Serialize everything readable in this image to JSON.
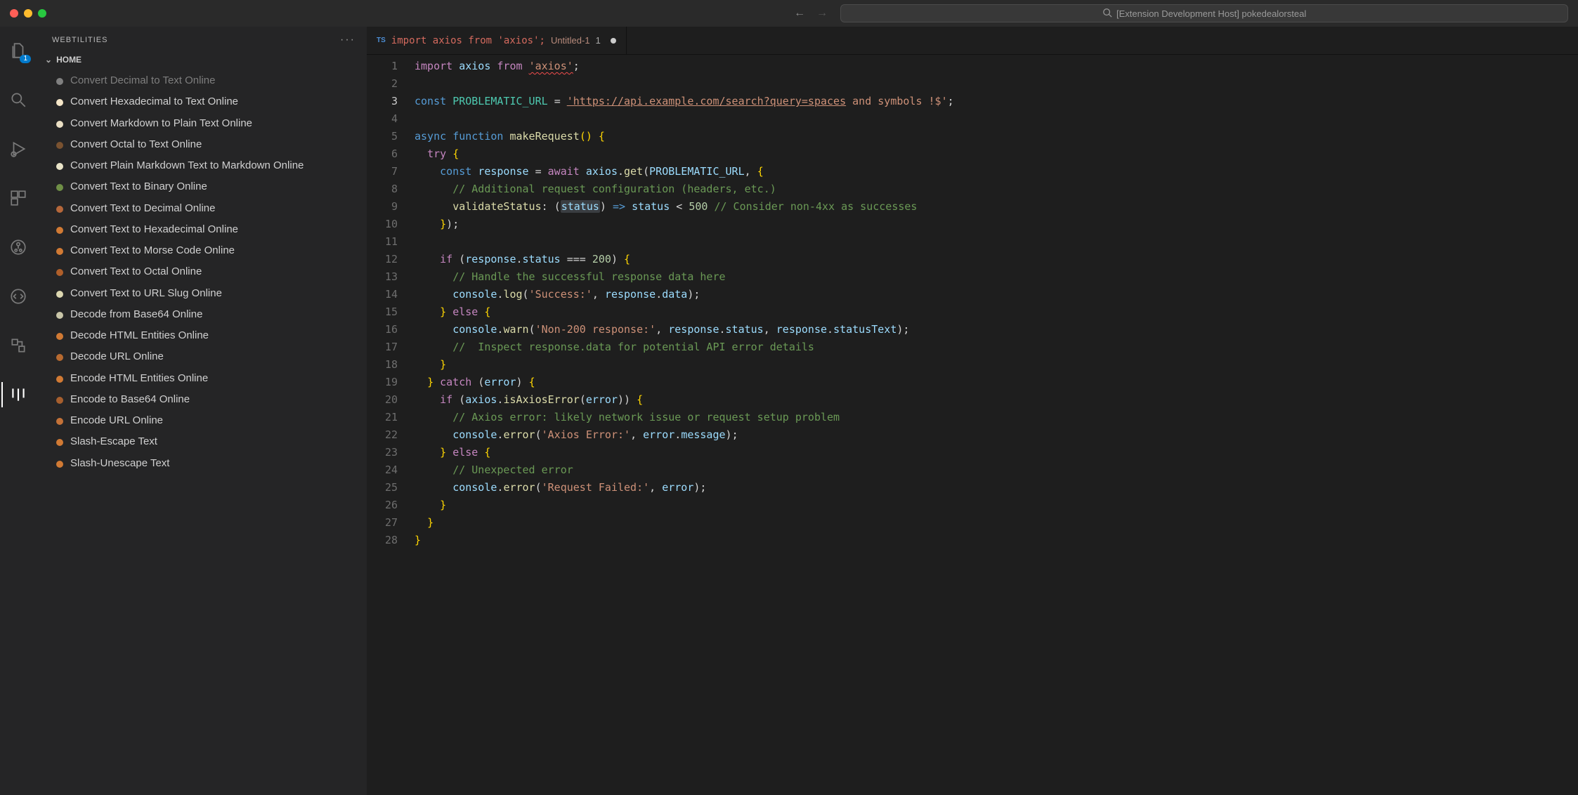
{
  "titlebar": {
    "search_placeholder": "[Extension Development Host] pokedealorsteal"
  },
  "activity": {
    "explorer_badge": "1"
  },
  "sidebar": {
    "title": "WEBTILITIES",
    "section": "HOME",
    "items": [
      {
        "label": "Convert Decimal to Text Online",
        "color": "#808080",
        "cut": true
      },
      {
        "label": "Convert Hexadecimal to Text Online",
        "color": "#f5e6c8"
      },
      {
        "label": "Convert Markdown to Plain Text Online",
        "color": "#eadfc4"
      },
      {
        "label": "Convert Octal to Text Online",
        "color": "#7a5230"
      },
      {
        "label": "Convert Plain Markdown Text to Markdown Online",
        "color": "#e9e4c8"
      },
      {
        "label": "Convert Text to Binary Online",
        "color": "#6f8f46"
      },
      {
        "label": "Convert Text to Decimal Online",
        "color": "#b5673a"
      },
      {
        "label": "Convert Text to Hexadecimal Online",
        "color": "#d17a34"
      },
      {
        "label": "Convert Text to Morse Code Online",
        "color": "#d17a34"
      },
      {
        "label": "Convert Text to Octal Online",
        "color": "#b05f2a"
      },
      {
        "label": "Convert Text to URL Slug Online",
        "color": "#dcd7b0"
      },
      {
        "label": "Decode from Base64 Online",
        "color": "#c9c6a8"
      },
      {
        "label": "Decode HTML Entities Online",
        "color": "#d17a34"
      },
      {
        "label": "Decode URL Online",
        "color": "#b86a30"
      },
      {
        "label": "Encode HTML Entities Online",
        "color": "#d17a34"
      },
      {
        "label": "Encode to Base64 Online",
        "color": "#a75f2e"
      },
      {
        "label": "Encode URL Online",
        "color": "#c47238"
      },
      {
        "label": "Slash-Escape Text",
        "color": "#d17a34"
      },
      {
        "label": "Slash-Unescape Text",
        "color": "#d17a34"
      }
    ]
  },
  "editor": {
    "tab": {
      "lang_badge": "TS",
      "title": "import axios from 'axios';",
      "sub": "Untitled-1",
      "num": "1"
    },
    "line_count": 28,
    "highlighted_line": 3,
    "strings": {
      "axios_module": "'axios'",
      "url_part1": "'https://api.example.com/search?query=spaces",
      "url_part2": " and symbols !$'",
      "success_label": "'Success:'",
      "non200_label": "'Non-200 response:'",
      "axios_err_label": "'Axios Error:'",
      "req_failed_label": "'Request Failed:'"
    },
    "identifiers": {
      "const_url": "PROBLEMATIC_URL",
      "fn_name": "makeRequest",
      "response": "response",
      "axios": "axios",
      "validateStatus": "validateStatus",
      "status_param": "status",
      "error": "error",
      "console": "console",
      "data_prop": "data",
      "status_prop": "status",
      "statusText_prop": "statusText",
      "message_prop": "message",
      "isAxiosError": "isAxiosError",
      "get": "get",
      "log": "log",
      "warn": "warn",
      "errorfn": "error"
    },
    "numbers": {
      "n500": "500",
      "n200": "200"
    },
    "comments": {
      "c1": "// Additional request configuration (headers, etc.)",
      "c2": "// Consider non-4xx as successes",
      "c3": "// Handle the successful response data here",
      "c4": "//  Inspect response.data for potential API error details",
      "c5": "// Axios error: likely network issue or request setup problem",
      "c6": "// Unexpected error"
    }
  }
}
